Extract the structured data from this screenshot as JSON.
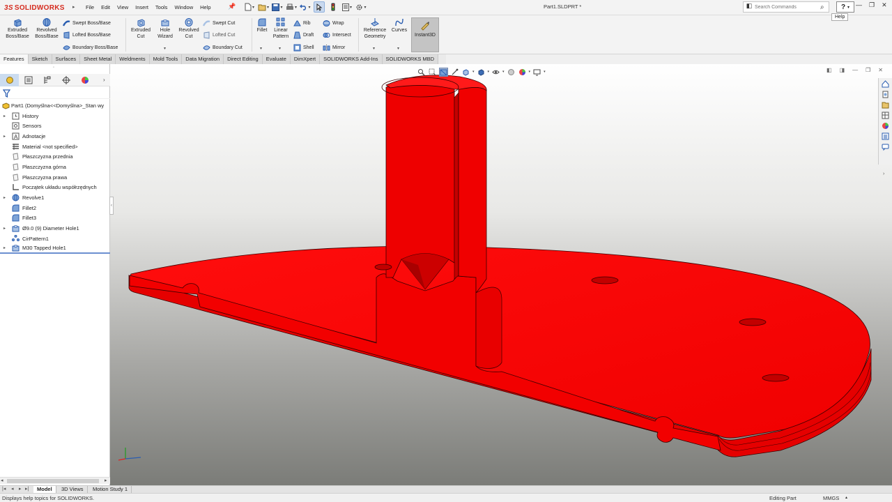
{
  "app": {
    "brand_prefix": "3S",
    "brand": "SOLIDWORKS",
    "document_title": "Part1.SLDPRT *"
  },
  "menu": [
    "File",
    "Edit",
    "View",
    "Insert",
    "Tools",
    "Window",
    "Help"
  ],
  "search": {
    "placeholder": "Search Commands"
  },
  "help": {
    "button": "?",
    "tooltip": "Help"
  },
  "features_toolbar": {
    "extruded_boss": "Extruded Boss/Base",
    "revolved_boss": "Revolved Boss/Base",
    "swept_boss": "Swept Boss/Base",
    "lofted_boss": "Lofted Boss/Base",
    "boundary_boss": "Boundary Boss/Base",
    "extruded_cut": "Extruded Cut",
    "hole_wizard": "Hole Wizard",
    "revolved_cut": "Revolved Cut",
    "swept_cut": "Swept Cut",
    "lofted_cut": "Lofted Cut",
    "boundary_cut": "Boundary Cut",
    "fillet": "Fillet",
    "linear_pattern": "Linear Pattern",
    "rib": "Rib",
    "draft": "Draft",
    "shell": "Shell",
    "wrap": "Wrap",
    "intersect": "Intersect",
    "mirror": "Mirror",
    "reference_geometry": "Reference Geometry",
    "curves": "Curves",
    "instant3d": "Instant3D"
  },
  "tabs": [
    "Features",
    "Sketch",
    "Surfaces",
    "Sheet Metal",
    "Weldments",
    "Mold Tools",
    "Data Migration",
    "Direct Editing",
    "Evaluate",
    "DimXpert",
    "SOLIDWORKS Add-Ins",
    "SOLIDWORKS MBD"
  ],
  "active_tab": "Features",
  "feature_tree": {
    "root": "Part1  (Domyślna<<Domyślna>_Stan wy",
    "items": [
      {
        "label": "History",
        "icon": "history-icon",
        "expandable": true
      },
      {
        "label": "Sensors",
        "icon": "sensors-icon",
        "expandable": false
      },
      {
        "label": "Adnotacje",
        "icon": "annotations-icon",
        "expandable": true
      },
      {
        "label": "Material <not specified>",
        "icon": "material-icon",
        "expandable": false
      },
      {
        "label": "Płaszczyzna przednia",
        "icon": "plane-icon",
        "expandable": false
      },
      {
        "label": "Płaszczyzna górna",
        "icon": "plane-icon",
        "expandable": false
      },
      {
        "label": "Płaszczyzna prawa",
        "icon": "plane-icon",
        "expandable": false
      },
      {
        "label": "Początek układu współrzędnych",
        "icon": "origin-icon",
        "expandable": false
      },
      {
        "label": "Revolve1",
        "icon": "revolve-icon",
        "expandable": true
      },
      {
        "label": "Fillet2",
        "icon": "fillet-icon",
        "expandable": false
      },
      {
        "label": "Fillet3",
        "icon": "fillet-icon",
        "expandable": false
      },
      {
        "label": "Ø9.0 (9) Diameter Hole1",
        "icon": "hole-icon",
        "expandable": true
      },
      {
        "label": "CirPattern1",
        "icon": "circular-pattern-icon",
        "expandable": false
      },
      {
        "label": "M30 Tapped Hole1",
        "icon": "hole-icon",
        "expandable": true
      }
    ]
  },
  "bottom_tabs": [
    "Model",
    "3D Views",
    "Motion Study 1"
  ],
  "active_bottom_tab": "Model",
  "status": {
    "message": "Displays help topics for SOLIDWORKS.",
    "mode": "Editing Part",
    "units": "MMGS"
  },
  "colors": {
    "part": "#f20000",
    "part_edge": "#3a0000",
    "accent": "#2a5db0",
    "brand": "#d52b1e"
  }
}
